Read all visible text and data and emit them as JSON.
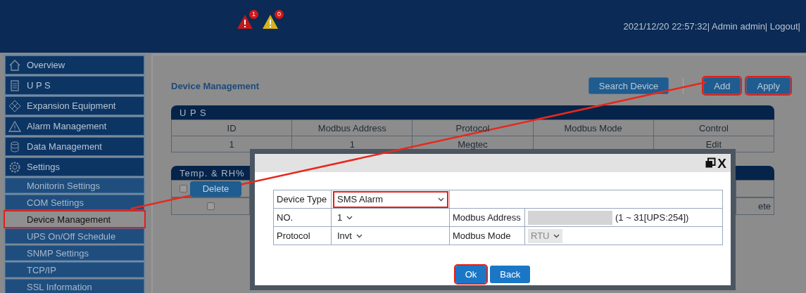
{
  "header": {
    "alarms": [
      {
        "kind": "critical",
        "count": "1"
      },
      {
        "kind": "warning",
        "count": "0"
      }
    ],
    "status": "2021/12/20 22:57:32| Admin admin| Logout|"
  },
  "sidebar": {
    "items": [
      {
        "label": "Overview"
      },
      {
        "label": "U P S"
      },
      {
        "label": "Expansion Equipment"
      },
      {
        "label": "Alarm Management"
      },
      {
        "label": "Data Management"
      },
      {
        "label": "Settings",
        "children": [
          {
            "label": "Monitorin Settings",
            "selected": false,
            "highlighted": false
          },
          {
            "label": "COM Settings",
            "selected": false,
            "highlighted": false
          },
          {
            "label": "Device Management",
            "selected": true,
            "highlighted": true
          },
          {
            "label": "UPS On/Off Schedule",
            "selected": false,
            "highlighted": false
          },
          {
            "label": "SNMP Settings",
            "selected": false,
            "highlighted": false
          },
          {
            "label": "TCP/IP",
            "selected": false,
            "highlighted": false
          },
          {
            "label": "SSL Information",
            "selected": false,
            "highlighted": false
          }
        ]
      }
    ]
  },
  "main": {
    "title": "Device Management",
    "toolbar": [
      {
        "label": "Search Device",
        "highlighted": false
      },
      {
        "label": "Add",
        "highlighted": true
      },
      {
        "label": "Apply",
        "highlighted": true
      }
    ],
    "ups_panel": {
      "title": "U P S",
      "columns": [
        "ID",
        "Modbus Address",
        "Protocol",
        "Modbus Mode",
        "Control"
      ],
      "rows": [
        [
          "1",
          "1",
          "Megtec",
          null,
          "Edit"
        ]
      ]
    },
    "temp_panel": {
      "title": "Temp. & RH%",
      "select_all": {
        "checked": false
      },
      "delete_button": "Delete",
      "rows": [
        {
          "checked": false
        }
      ],
      "column_5_cell": "ete"
    }
  },
  "dialog": {
    "close": "X",
    "device_type": {
      "label": "Device Type",
      "value": "SMS Alarm",
      "highlighted": true
    },
    "no": {
      "label": "NO.",
      "value": "1"
    },
    "modbus_address": {
      "label": "Modbus Address",
      "hint": "(1 ~ 31[UPS:254])"
    },
    "protocol": {
      "label": "Protocol",
      "value": "Invt"
    },
    "modbus_mode": {
      "label": "Modbus Mode",
      "value": "RTU",
      "disabled": true
    },
    "buttons": [
      {
        "label": "Ok",
        "highlighted": true
      },
      {
        "label": "Back",
        "highlighted": false
      }
    ]
  }
}
